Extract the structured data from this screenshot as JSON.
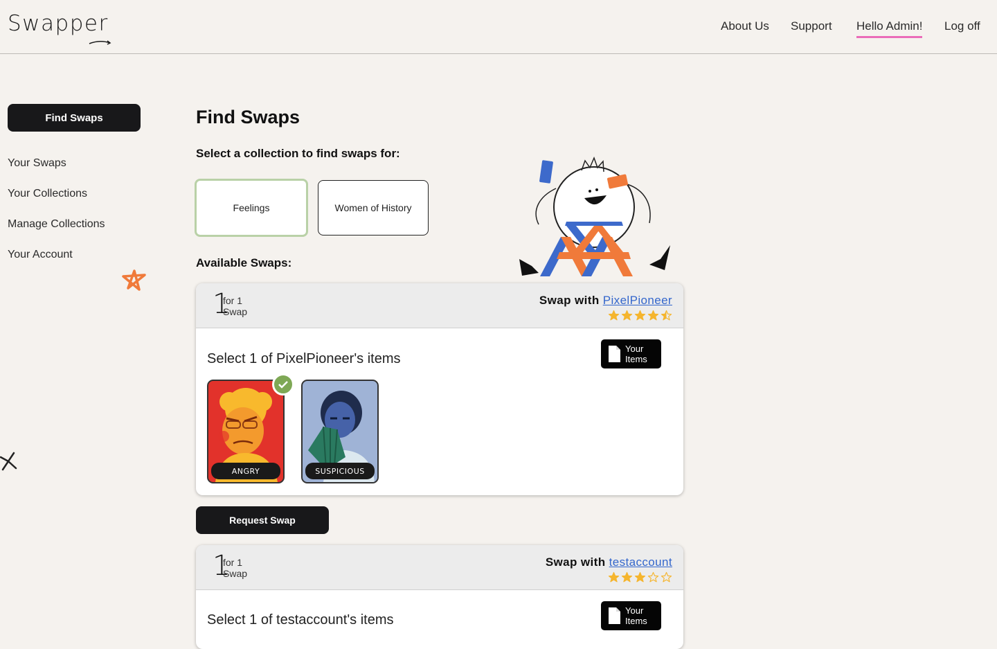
{
  "app": {
    "logo": "Swapper"
  },
  "nav": {
    "about": "About Us",
    "support": "Support",
    "hello": "Hello Admin!",
    "logoff": "Log off"
  },
  "sidebar": {
    "active": "Find Swaps",
    "items": [
      "Your Swaps",
      "Your Collections",
      "Manage Collections",
      "Your Account"
    ]
  },
  "main": {
    "title": "Find Swaps",
    "select_collection_label": "Select a collection to find swaps for:",
    "collections": [
      {
        "name": "Feelings",
        "selected": true
      },
      {
        "name": "Women of History",
        "selected": false
      }
    ],
    "available_label": "Available Swaps:",
    "request_button": "Request Swap"
  },
  "swaps": [
    {
      "ratio_num": "1",
      "ratio_for": "for 1",
      "ratio_swap": "Swap",
      "swap_with_label": "Swap with",
      "user": "PixelPioneer",
      "rating": 4.5,
      "select_label": "Select 1 of PixelPioneer's items",
      "your_items_line1": "Your",
      "your_items_line2": "Items",
      "items": [
        {
          "label": "ANGRY",
          "selected": true
        },
        {
          "label": "SUSPICIOUS",
          "selected": false
        }
      ]
    },
    {
      "ratio_num": "1",
      "ratio_for": "for 1",
      "ratio_swap": "Swap",
      "swap_with_label": "Swap with",
      "user": "testaccount",
      "rating": 3,
      "select_label": "Select 1 of testaccount's items",
      "your_items_line1": "Your",
      "your_items_line2": "Items"
    }
  ],
  "colors": {
    "accent_pink": "#ea6cb9",
    "star": "#f5b52e",
    "link": "#3366cc",
    "selected_border": "#b9d1a7",
    "check": "#7ea855"
  }
}
